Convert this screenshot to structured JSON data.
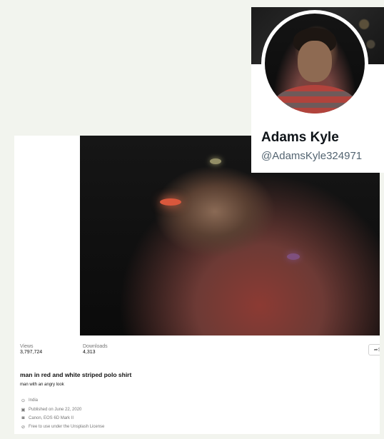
{
  "photo": {
    "title": "man in red and white striped polo shirt",
    "description": "man with an angry look",
    "stats": {
      "views_label": "Views",
      "views_value": "3,797,724",
      "downloads_label": "Downloads",
      "downloads_value": "4,313"
    },
    "share_label": "S",
    "meta": {
      "location": "India",
      "published": "Published on June 22, 2020",
      "camera": "Canon, EOS 6D Mark II",
      "license": "Free to use under the Unsplash License"
    }
  },
  "profile": {
    "name": "Adams Kyle",
    "handle": "@AdamsKyle324971"
  },
  "icons": {
    "location": "location-pin-icon",
    "calendar": "calendar-icon",
    "camera": "camera-icon",
    "license": "shield-check-icon",
    "share": "share-arrow-icon"
  },
  "colors": {
    "page_bg": "#f2f4ee",
    "name_text": "#0f1419",
    "handle_text": "#536471",
    "muted_text": "#767676"
  }
}
